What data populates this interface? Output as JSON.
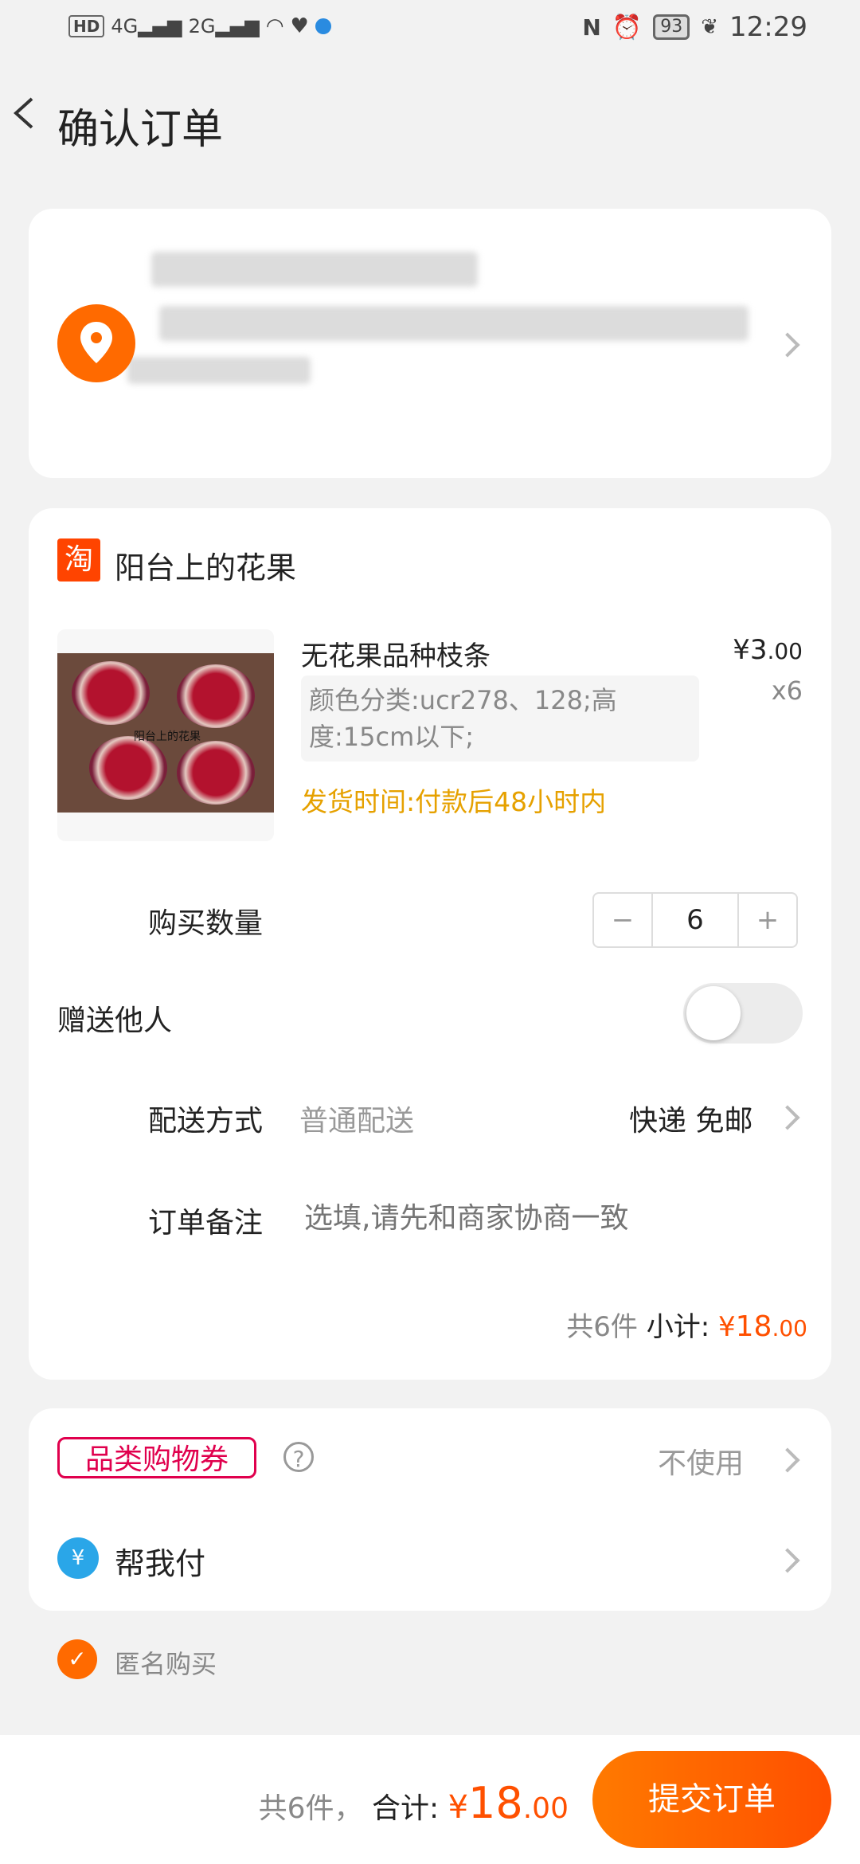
{
  "status_bar": {
    "left_indicators": [
      "HD",
      "4G",
      "2G"
    ],
    "battery": "93",
    "time": "12:29"
  },
  "header": {
    "title": "确认订单"
  },
  "shop": {
    "logo_text": "淘",
    "name": "阳台上的花果"
  },
  "product": {
    "name": "无花果品种枝条",
    "sku": "颜色分类:ucr278、128;高度:15cm以下;",
    "shipping_time": "发货时间:付款后48小时内",
    "price_symbol": "¥",
    "price_int": "3",
    "price_dec": ".00",
    "quantity_label": "x6",
    "image_watermark": "阳台上的花果"
  },
  "quantity": {
    "label": "购买数量",
    "minus": "−",
    "value": "6",
    "plus": "+"
  },
  "gift": {
    "label": "赠送他人",
    "enabled": false
  },
  "delivery": {
    "label": "配送方式",
    "value": "普通配送",
    "right": "快递 免邮"
  },
  "note": {
    "label": "订单备注",
    "placeholder": "选填,请先和商家协商一致"
  },
  "subtotal": {
    "count": "共6件",
    "label": "小计:",
    "symbol": "¥",
    "int": "18",
    "dec": ".00"
  },
  "coupon": {
    "label": "品类购物券",
    "help": "?",
    "value": "不使用"
  },
  "help_pay": {
    "icon": "¥",
    "label": "帮我付"
  },
  "anonymous": {
    "label": "匿名购买",
    "checked": true
  },
  "footer": {
    "count": "共6件，",
    "total_label": "合计:",
    "symbol": "¥",
    "int": "18",
    "dec": ".00",
    "submit": "提交订单"
  },
  "colors": {
    "accent": "#ff5000",
    "shipping": "#e6a100",
    "coupon": "#e0004d"
  }
}
